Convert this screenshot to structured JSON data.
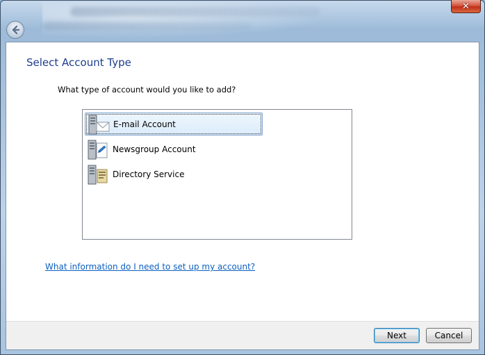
{
  "window": {
    "close_glyph": "✕"
  },
  "page": {
    "title": "Select Account Type",
    "question": "What type of account would you like to add?"
  },
  "account_types": {
    "items": [
      {
        "label": "E-mail Account",
        "icon": "email-server-icon",
        "selected": true
      },
      {
        "label": "Newsgroup Account",
        "icon": "newsgroup-server-icon",
        "selected": false
      },
      {
        "label": "Directory Service",
        "icon": "directory-server-icon",
        "selected": false
      }
    ]
  },
  "help": {
    "link": "What information do I need to set up my account?"
  },
  "footer": {
    "next_label": "Next",
    "cancel_label": "Cancel"
  },
  "colors": {
    "title": "#1e3d8f",
    "link": "#0b5fbf",
    "selection_border": "#7da2ce",
    "close_button": "#c0301a"
  }
}
